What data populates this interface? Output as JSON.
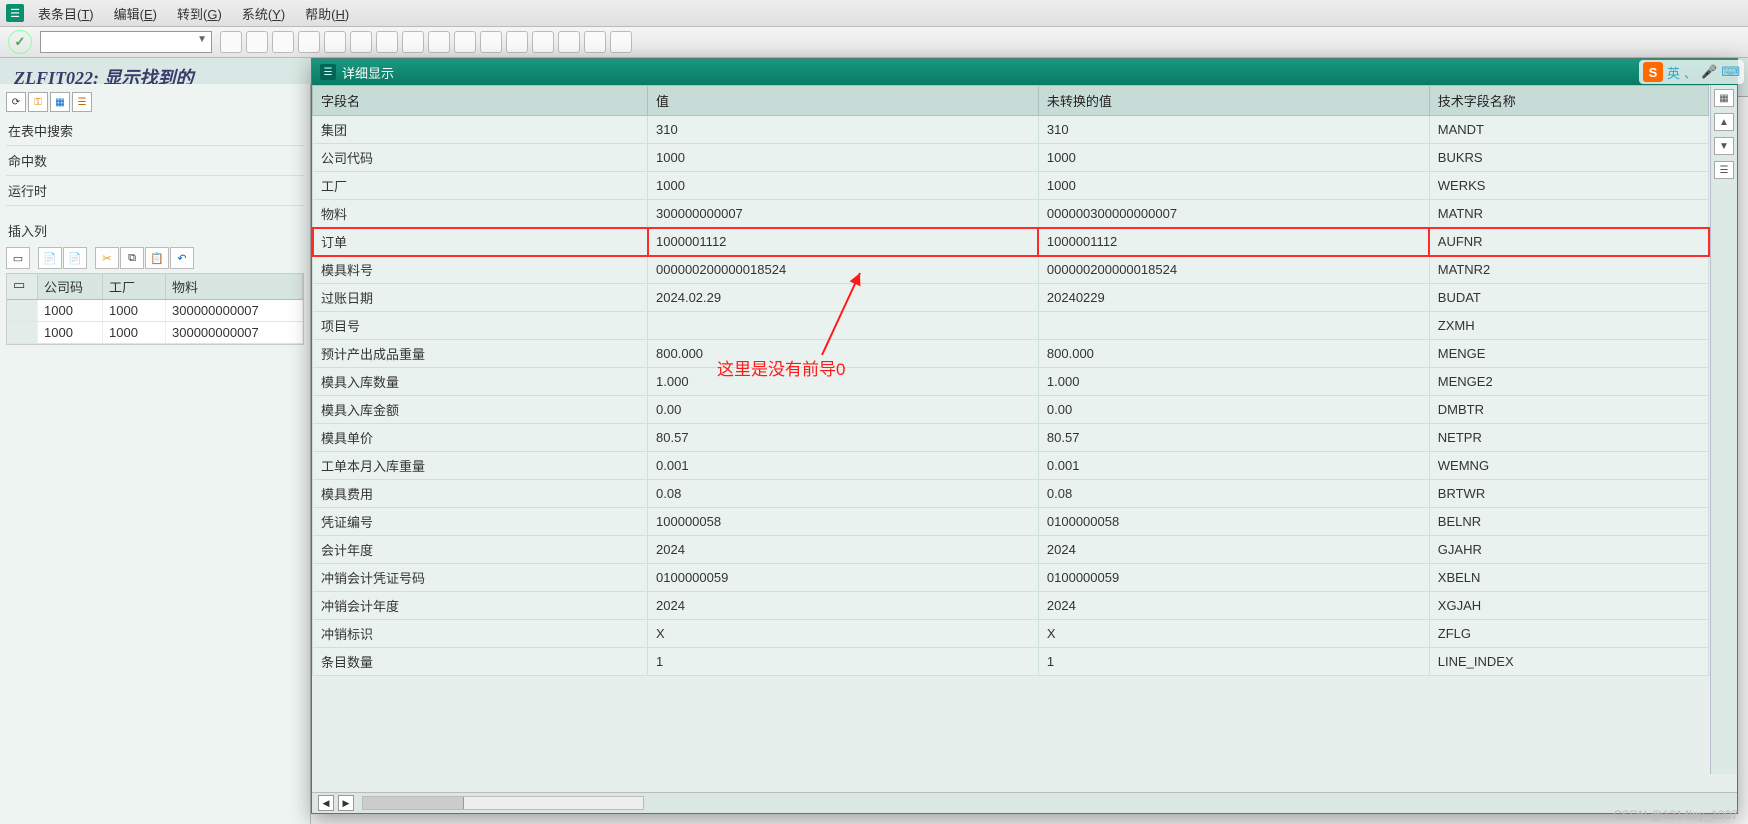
{
  "menu": {
    "items": [
      {
        "label": "表条目",
        "accel": "T"
      },
      {
        "label": "编辑",
        "accel": "E"
      },
      {
        "label": "转到",
        "accel": "G"
      },
      {
        "label": "系统",
        "accel": "Y"
      },
      {
        "label": "帮助",
        "accel": "H"
      }
    ]
  },
  "page": {
    "title": "ZLFIT022:  显示找到的"
  },
  "left": {
    "search_label": "在表中搜索",
    "hits_label": "命中数",
    "runtime_label": "运行时",
    "insert_label": "插入列",
    "grid": {
      "headers": {
        "company": "公司码",
        "plant": "工厂",
        "material": "物料"
      },
      "rows": [
        {
          "company": "1000",
          "plant": "1000",
          "material": "300000000007"
        },
        {
          "company": "1000",
          "plant": "1000",
          "material": "300000000007"
        }
      ]
    }
  },
  "dialog": {
    "title": "详细显示",
    "columns": {
      "field": "字段名",
      "value": "值",
      "raw": "未转换的值",
      "tech": "技术字段名称"
    },
    "rows": [
      {
        "field": "集团",
        "value": "310",
        "raw": "310",
        "tech": "MANDT"
      },
      {
        "field": "公司代码",
        "value": "1000",
        "raw": "1000",
        "tech": "BUKRS"
      },
      {
        "field": "工厂",
        "value": "1000",
        "raw": "1000",
        "tech": "WERKS"
      },
      {
        "field": "物料",
        "value": "300000000007",
        "raw": "000000300000000007",
        "tech": "MATNR"
      },
      {
        "field": "订单",
        "value": "1000001112",
        "raw": "1000001112",
        "tech": "AUFNR",
        "highlight": true
      },
      {
        "field": "模具料号",
        "value": "000000200000018524",
        "raw": "000000200000018524",
        "tech": "MATNR2"
      },
      {
        "field": "过账日期",
        "value": "2024.02.29",
        "raw": "20240229",
        "tech": "BUDAT"
      },
      {
        "field": "项目号",
        "value": "",
        "raw": "",
        "tech": "ZXMH"
      },
      {
        "field": "预计产出成品重量",
        "value": "800.000",
        "raw": "800.000",
        "tech": "MENGE"
      },
      {
        "field": "模具入库数量",
        "value": "1.000",
        "raw": "1.000",
        "tech": "MENGE2"
      },
      {
        "field": "模具入库金额",
        "value": "0.00",
        "raw": "0.00",
        "tech": "DMBTR"
      },
      {
        "field": "模具单价",
        "value": "80.57",
        "raw": "80.57",
        "tech": "NETPR"
      },
      {
        "field": "工单本月入库重量",
        "value": "0.001",
        "raw": "0.001",
        "tech": "WEMNG"
      },
      {
        "field": "模具费用",
        "value": "0.08",
        "raw": "0.08",
        "tech": "BRTWR"
      },
      {
        "field": "凭证编号",
        "value": "100000058",
        "raw": "0100000058",
        "tech": "BELNR"
      },
      {
        "field": "会计年度",
        "value": "2024",
        "raw": "2024",
        "tech": "GJAHR"
      },
      {
        "field": "冲销会计凭证号码",
        "value": "0100000059",
        "raw": "0100000059",
        "tech": "XBELN"
      },
      {
        "field": "冲销会计年度",
        "value": "2024",
        "raw": "2024",
        "tech": "XGJAH"
      },
      {
        "field": "冲销标识",
        "value": "X",
        "raw": "X",
        "tech": "ZFLG"
      },
      {
        "field": "条目数量",
        "value": "1",
        "raw": "1",
        "tech": "LINE_INDEX"
      }
    ]
  },
  "annotation": {
    "text": "这里是没有前导0"
  },
  "ime": {
    "logo": "S",
    "lang": "英",
    "dot": "、",
    "mic": "🎤",
    "kbd": "⌨"
  },
  "watermark": "CSDN @1314lay_1007"
}
